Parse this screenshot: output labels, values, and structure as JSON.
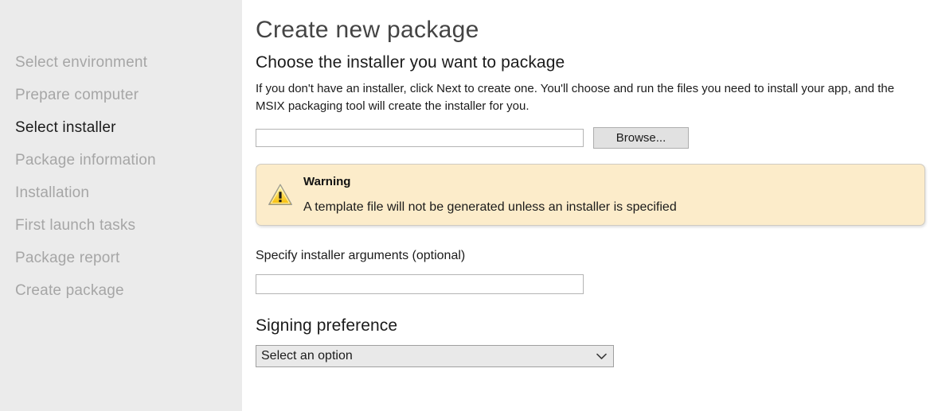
{
  "sidebar": {
    "items": [
      {
        "label": "Select environment",
        "active": false
      },
      {
        "label": "Prepare computer",
        "active": false
      },
      {
        "label": "Select installer",
        "active": true
      },
      {
        "label": "Package information",
        "active": false
      },
      {
        "label": "Installation",
        "active": false
      },
      {
        "label": "First launch tasks",
        "active": false
      },
      {
        "label": "Package report",
        "active": false
      },
      {
        "label": "Create package",
        "active": false
      }
    ]
  },
  "main": {
    "title": "Create new package",
    "section_heading": "Choose the installer you want to package",
    "section_description": "If you don't have an installer, click Next to create one. You'll choose and run the files you need to install your app, and the MSIX packaging tool will create the installer for you.",
    "installer_path": {
      "value": "",
      "placeholder": ""
    },
    "browse_label": "Browse...",
    "warning": {
      "icon": "warning-triangle-icon",
      "title": "Warning",
      "message": "A template file will not be generated unless an installer is specified",
      "background_color": "#fcecca",
      "border_color": "#cfcbc2",
      "icon_color": "#ffd035"
    },
    "arguments": {
      "label": "Specify installer arguments (optional)",
      "value": "",
      "placeholder": ""
    },
    "signing": {
      "heading": "Signing preference",
      "selected_option": "Select an option",
      "options": [
        "Select an option"
      ],
      "chevron_icon": "chevron-down-icon"
    }
  },
  "colors": {
    "sidebar_background": "#ebebeb",
    "sidebar_inactive_text": "#a6a6a6",
    "sidebar_active_text": "#1b1b1b",
    "page_background": "#ffffff",
    "button_face": "#e1e1e1",
    "button_border": "#adadad"
  }
}
